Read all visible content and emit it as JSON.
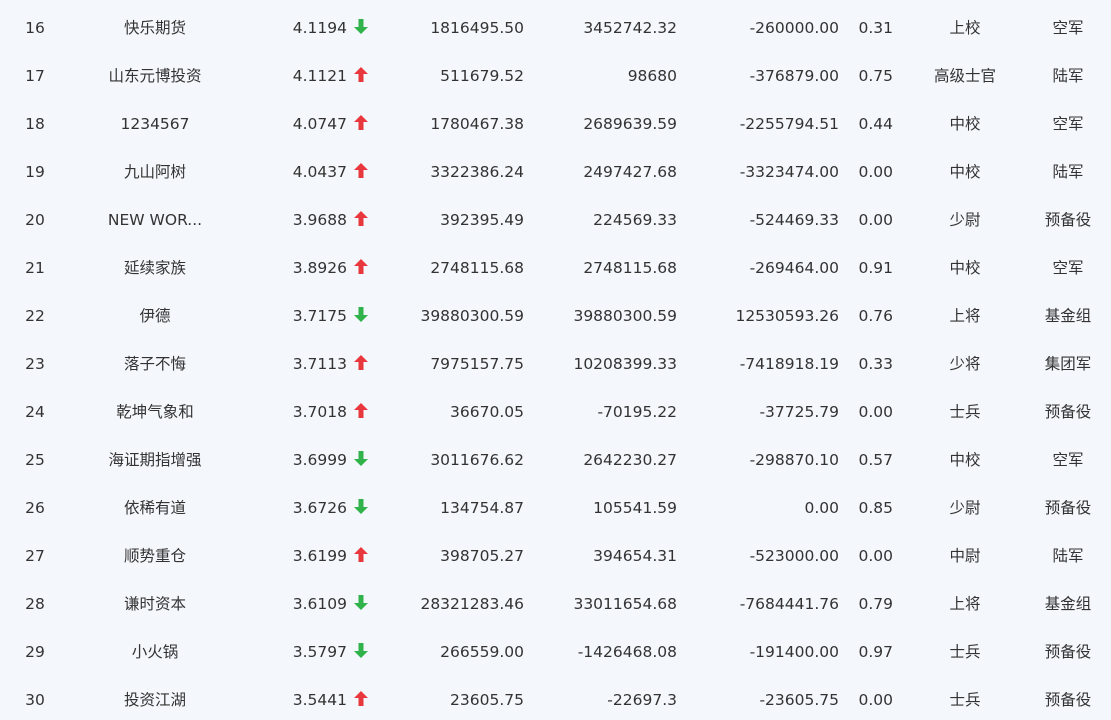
{
  "colors": {
    "up": "#e8383d",
    "down": "#2fb34a",
    "text": "#333333",
    "background": "#f4f7fb"
  },
  "rows": [
    {
      "rank": "16",
      "name": "快乐期货",
      "score": "4.1194",
      "trend": "down",
      "v1": "1816495.50",
      "v2": "3452742.32",
      "v3": "-260000.00",
      "ratio": "0.31",
      "title": "上校",
      "branch": "空军"
    },
    {
      "rank": "17",
      "name": "山东元博投资",
      "score": "4.1121",
      "trend": "up",
      "v1": "511679.52",
      "v2": "98680",
      "v3": "-376879.00",
      "ratio": "0.75",
      "title": "高级士官",
      "branch": "陆军"
    },
    {
      "rank": "18",
      "name": "1234567",
      "score": "4.0747",
      "trend": "up",
      "v1": "1780467.38",
      "v2": "2689639.59",
      "v3": "-2255794.51",
      "ratio": "0.44",
      "title": "中校",
      "branch": "空军"
    },
    {
      "rank": "19",
      "name": "九山阿树",
      "score": "4.0437",
      "trend": "up",
      "v1": "3322386.24",
      "v2": "2497427.68",
      "v3": "-3323474.00",
      "ratio": "0.00",
      "title": "中校",
      "branch": "陆军"
    },
    {
      "rank": "20",
      "name": "NEW WOR...",
      "score": "3.9688",
      "trend": "up",
      "v1": "392395.49",
      "v2": "224569.33",
      "v3": "-524469.33",
      "ratio": "0.00",
      "title": "少尉",
      "branch": "预备役"
    },
    {
      "rank": "21",
      "name": "延续家族",
      "score": "3.8926",
      "trend": "up",
      "v1": "2748115.68",
      "v2": "2748115.68",
      "v3": "-269464.00",
      "ratio": "0.91",
      "title": "中校",
      "branch": "空军"
    },
    {
      "rank": "22",
      "name": "伊德",
      "score": "3.7175",
      "trend": "down",
      "v1": "39880300.59",
      "v2": "39880300.59",
      "v3": "12530593.26",
      "ratio": "0.76",
      "title": "上将",
      "branch": "基金组"
    },
    {
      "rank": "23",
      "name": "落子不悔",
      "score": "3.7113",
      "trend": "up",
      "v1": "7975157.75",
      "v2": "10208399.33",
      "v3": "-7418918.19",
      "ratio": "0.33",
      "title": "少将",
      "branch": "集团军"
    },
    {
      "rank": "24",
      "name": "乾坤气象和",
      "score": "3.7018",
      "trend": "up",
      "v1": "36670.05",
      "v2": "-70195.22",
      "v3": "-37725.79",
      "ratio": "0.00",
      "title": "士兵",
      "branch": "预备役"
    },
    {
      "rank": "25",
      "name": "海证期指增强",
      "score": "3.6999",
      "trend": "down",
      "v1": "3011676.62",
      "v2": "2642230.27",
      "v3": "-298870.10",
      "ratio": "0.57",
      "title": "中校",
      "branch": "空军"
    },
    {
      "rank": "26",
      "name": "依稀有道",
      "score": "3.6726",
      "trend": "down",
      "v1": "134754.87",
      "v2": "105541.59",
      "v3": "0.00",
      "ratio": "0.85",
      "title": "少尉",
      "branch": "预备役"
    },
    {
      "rank": "27",
      "name": "顺势重仓",
      "score": "3.6199",
      "trend": "up",
      "v1": "398705.27",
      "v2": "394654.31",
      "v3": "-523000.00",
      "ratio": "0.00",
      "title": "中尉",
      "branch": "陆军"
    },
    {
      "rank": "28",
      "name": "谦时资本",
      "score": "3.6109",
      "trend": "down",
      "v1": "28321283.46",
      "v2": "33011654.68",
      "v3": "-7684441.76",
      "ratio": "0.79",
      "title": "上将",
      "branch": "基金组"
    },
    {
      "rank": "29",
      "name": "小火锅",
      "score": "3.5797",
      "trend": "down",
      "v1": "266559.00",
      "v2": "-1426468.08",
      "v3": "-191400.00",
      "ratio": "0.97",
      "title": "士兵",
      "branch": "预备役"
    },
    {
      "rank": "30",
      "name": "投资江湖",
      "score": "3.5441",
      "trend": "up",
      "v1": "23605.75",
      "v2": "-22697.3",
      "v3": "-23605.75",
      "ratio": "0.00",
      "title": "士兵",
      "branch": "预备役"
    }
  ]
}
